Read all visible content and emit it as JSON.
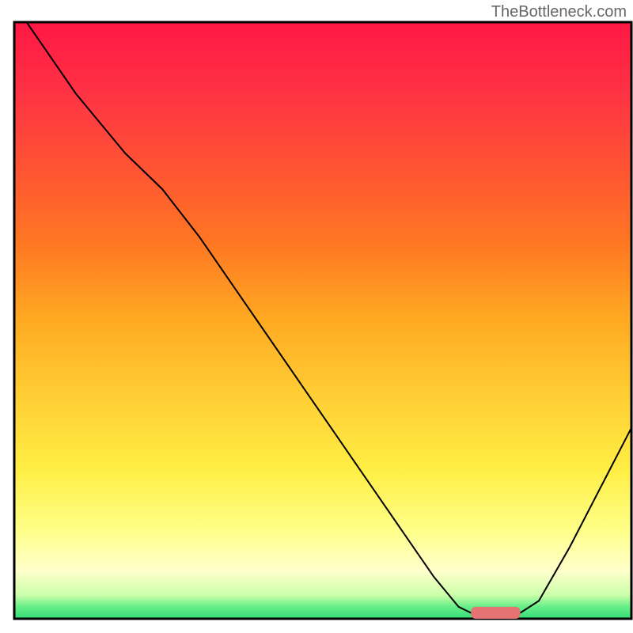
{
  "watermark": "TheBottleneck.com",
  "chart_data": {
    "type": "line",
    "title": "",
    "xlabel": "",
    "ylabel": "",
    "xlim": [
      0,
      100
    ],
    "ylim": [
      0,
      100
    ],
    "background_gradient": {
      "stops": [
        {
          "offset": 0,
          "color": "#ff1744"
        },
        {
          "offset": 12,
          "color": "#ff3344"
        },
        {
          "offset": 25,
          "color": "#ff5533"
        },
        {
          "offset": 37,
          "color": "#ff7722"
        },
        {
          "offset": 50,
          "color": "#ffaa22"
        },
        {
          "offset": 62,
          "color": "#ffcc33"
        },
        {
          "offset": 75,
          "color": "#ffee44"
        },
        {
          "offset": 85,
          "color": "#ffff88"
        },
        {
          "offset": 92,
          "color": "#ffffcc"
        },
        {
          "offset": 96,
          "color": "#ccffaa"
        },
        {
          "offset": 98,
          "color": "#66ee88"
        },
        {
          "offset": 100,
          "color": "#33dd77"
        }
      ]
    },
    "series": [
      {
        "name": "bottleneck-curve",
        "color": "#000000",
        "width": 2,
        "points": [
          {
            "x": 2,
            "y": 100
          },
          {
            "x": 10,
            "y": 88
          },
          {
            "x": 18,
            "y": 78
          },
          {
            "x": 24,
            "y": 72
          },
          {
            "x": 30,
            "y": 64
          },
          {
            "x": 40,
            "y": 49
          },
          {
            "x": 50,
            "y": 34
          },
          {
            "x": 60,
            "y": 19
          },
          {
            "x": 68,
            "y": 7
          },
          {
            "x": 72,
            "y": 2
          },
          {
            "x": 74,
            "y": 1
          },
          {
            "x": 78,
            "y": 1
          },
          {
            "x": 82,
            "y": 1
          },
          {
            "x": 85,
            "y": 3
          },
          {
            "x": 90,
            "y": 12
          },
          {
            "x": 95,
            "y": 22
          },
          {
            "x": 100,
            "y": 32
          }
        ]
      }
    ],
    "markers": [
      {
        "name": "optimal-range",
        "type": "bar",
        "x_start": 74,
        "x_end": 82,
        "y": 1,
        "color": "#e57373",
        "height": 2
      }
    ],
    "axes": {
      "show_ticks": false,
      "show_labels": false,
      "border_color": "#000000",
      "border_width": 3
    }
  }
}
